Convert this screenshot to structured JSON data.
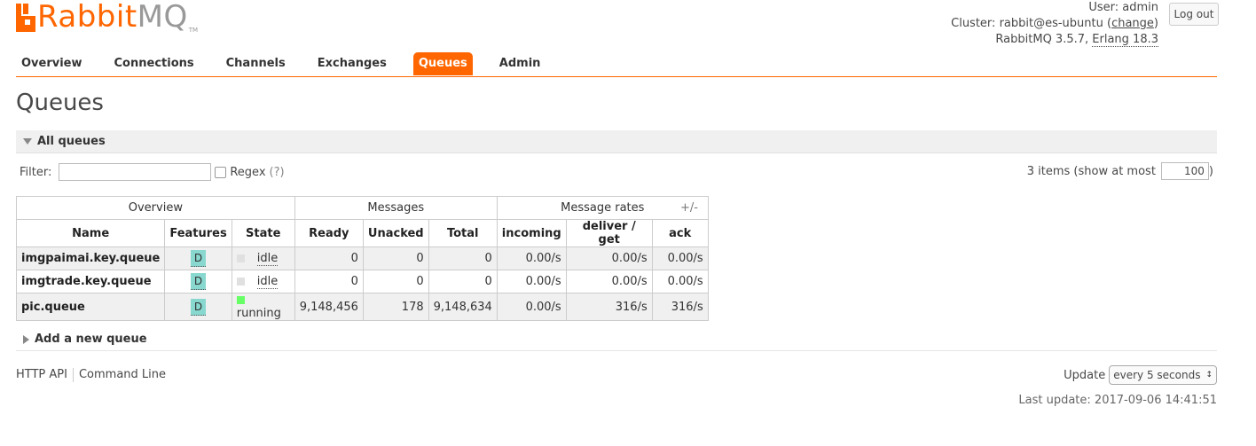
{
  "logo": {
    "rabbit": "Rabbit",
    "mq": "MQ",
    "tm": "TM"
  },
  "header": {
    "user_label": "User:",
    "user_value": "admin",
    "cluster_label": "Cluster:",
    "cluster_value": "rabbit@es-ubuntu",
    "cluster_change_open": "(",
    "cluster_change_link": "change",
    "cluster_change_close": ")",
    "version_text": "RabbitMQ 3.5.7,",
    "erlang_text": "Erlang 18.3",
    "logout_label": "Log out"
  },
  "tabs": [
    {
      "label": "Overview"
    },
    {
      "label": "Connections"
    },
    {
      "label": "Channels"
    },
    {
      "label": "Exchanges"
    },
    {
      "label": "Queues",
      "selected": true
    },
    {
      "label": "Admin"
    }
  ],
  "page_title": "Queues",
  "all_queues": {
    "section_label": "All queues",
    "filter_label": "Filter:",
    "filter_value": "",
    "regex_label": "Regex",
    "regex_help": "(?)",
    "items_text": "3 items (show at most",
    "max_value": "100",
    "items_close": ")"
  },
  "table": {
    "groups": [
      "Overview",
      "Messages",
      "Message rates"
    ],
    "columns": [
      "Name",
      "Features",
      "State",
      "Ready",
      "Unacked",
      "Total",
      "incoming",
      "deliver / get",
      "ack"
    ],
    "plusminus": "+/-",
    "rows": [
      {
        "name": "imgpaimai.key.queue",
        "feature": "D",
        "state": "idle",
        "ready": "0",
        "unacked": "0",
        "total": "0",
        "incoming": "0.00/s",
        "deliver": "0.00/s",
        "ack": "0.00/s"
      },
      {
        "name": "imgtrade.key.queue",
        "feature": "D",
        "state": "idle",
        "ready": "0",
        "unacked": "0",
        "total": "0",
        "incoming": "0.00/s",
        "deliver": "0.00/s",
        "ack": "0.00/s"
      },
      {
        "name": "pic.queue",
        "feature": "D",
        "state": "running",
        "ready": "9,148,456",
        "unacked": "178",
        "total": "9,148,634",
        "incoming": "0.00/s",
        "deliver": "316/s",
        "ack": "316/s"
      }
    ]
  },
  "add_queue": {
    "section_label": "Add a new queue"
  },
  "footer": {
    "http_api": "HTTP API",
    "command_line": "Command Line",
    "update_label": "Update",
    "update_value": "every 5 seconds",
    "last_update": "Last update: 2017-09-06 14:41:51"
  },
  "colors": {
    "accent": "#ff6600",
    "row_alt": "#f0f0f0",
    "feature_badge": "#88d8d0",
    "running": "#66ff66"
  }
}
